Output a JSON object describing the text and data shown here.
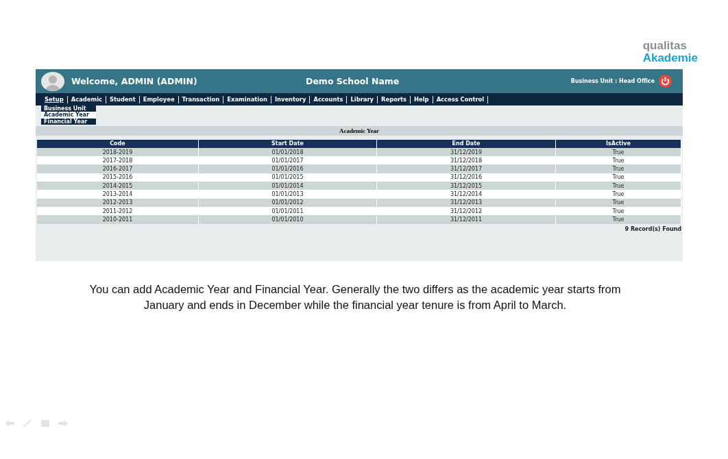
{
  "logo": {
    "line_1": "qualitas",
    "line_2": "Akademie"
  },
  "header": {
    "welcome": "Welcome, ADMIN (ADMIN)",
    "school": "Demo School Name",
    "business_unit": "Business Unit : Head Office"
  },
  "menu": [
    {
      "label": "Setup",
      "selected": true
    },
    {
      "label": "Academic",
      "selected": false
    },
    {
      "label": "Student",
      "selected": false
    },
    {
      "label": "Employee",
      "selected": false
    },
    {
      "label": "Transaction",
      "selected": false
    },
    {
      "label": "Examination",
      "selected": false
    },
    {
      "label": "Inventory",
      "selected": false
    },
    {
      "label": "Accounts",
      "selected": false
    },
    {
      "label": "Library",
      "selected": false
    },
    {
      "label": "Reports",
      "selected": false
    },
    {
      "label": "Help",
      "selected": false
    },
    {
      "label": "Access Control",
      "selected": false
    }
  ],
  "submenu": [
    {
      "label": "Business Unit",
      "selected": false
    },
    {
      "label": "Academic Year",
      "selected": true
    },
    {
      "label": "Financial Year",
      "selected": false
    }
  ],
  "panel_title": "Academic Year",
  "table": {
    "columns": [
      "Code",
      "Start Date",
      "End Date",
      "IsActive"
    ],
    "rows": [
      [
        "2018-2019",
        "01/01/2018",
        "31/12/2019",
        "True"
      ],
      [
        "2017-2018",
        "01/01/2017",
        "31/12/2018",
        "True"
      ],
      [
        "2016-2017",
        "01/01/2016",
        "31/12/2017",
        "True"
      ],
      [
        "2015-2016",
        "01/01/2015",
        "31/12/2016",
        "True"
      ],
      [
        "2014-2015",
        "01/01/2014",
        "31/12/2015",
        "True"
      ],
      [
        "2013-2014",
        "01/01/2013",
        "31/12/2014",
        "True"
      ],
      [
        "2012-2013",
        "01/01/2012",
        "31/12/2013",
        "True"
      ],
      [
        "2011-2012",
        "01/01/2011",
        "31/12/2012",
        "True"
      ],
      [
        "2010-2011",
        "01/01/2010",
        "31/12/2011",
        "True"
      ]
    ]
  },
  "record_count": "9 Record(s) Found",
  "caption": "You can add Academic Year and Financial Year. Generally the two differs as the academic year starts from January and ends in December while the financial year tenure is from April to March."
}
